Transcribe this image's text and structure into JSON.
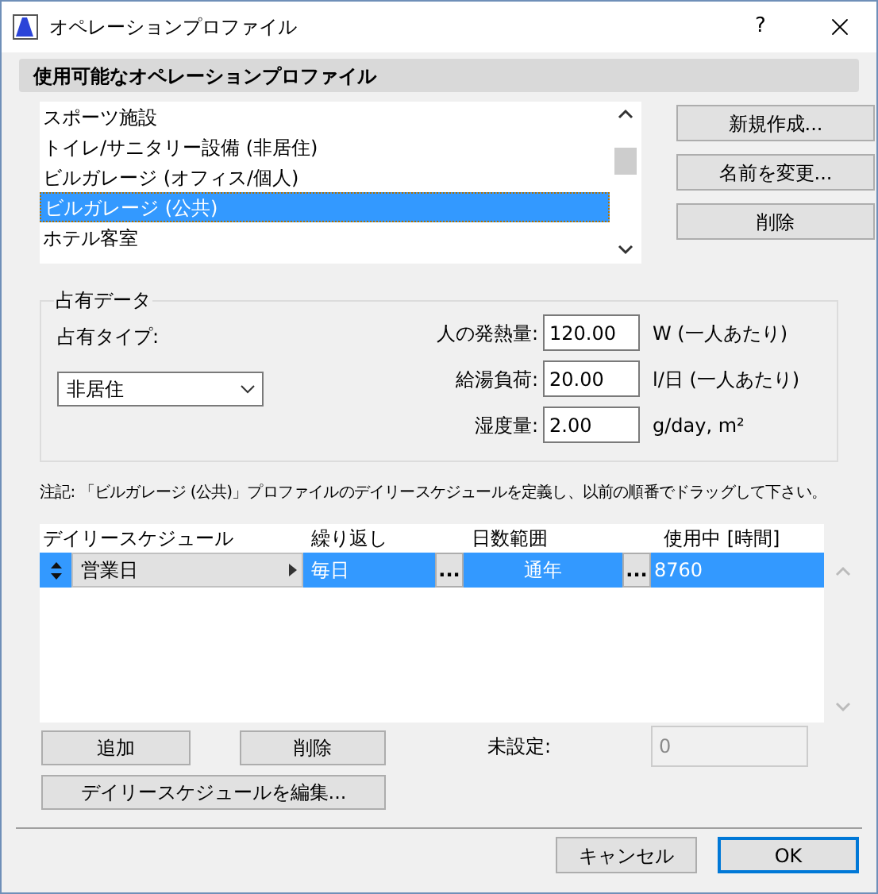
{
  "window": {
    "title": "オペレーションプロファイル",
    "help": "?"
  },
  "available_profiles": {
    "header": "使用可能なオペレーションプロファイル",
    "items": [
      {
        "label": "スポーツ施設",
        "selected": false
      },
      {
        "label": "トイレ/サニタリー設備 (非居住)",
        "selected": false
      },
      {
        "label": "ビルガレージ (オフィス/個人)",
        "selected": false
      },
      {
        "label": "ビルガレージ (公共)",
        "selected": true
      },
      {
        "label": "ホテル客室",
        "selected": false
      }
    ],
    "buttons": [
      "新規作成...",
      "名前を変更...",
      "削除"
    ]
  },
  "occupancy": {
    "title": "占有データ",
    "type_label": "占有タイプ:",
    "type_value": "非居住",
    "fields": [
      {
        "label": "人の発熱量:",
        "value": "120.00",
        "unit": "W (一人あたり)"
      },
      {
        "label": "給湯負荷:",
        "value": "20.00",
        "unit": "l/日 (一人あたり)"
      },
      {
        "label": "湿度量:",
        "value": "2.00",
        "unit": "g/day, m²"
      }
    ]
  },
  "note": "注記: 「ビルガレージ (公共)」プロファイルのデイリースケジュールを定義し、以前の順番でドラッグして下さい。",
  "schedule_table": {
    "columns": [
      "デイリースケジュール",
      "繰り返し",
      "日数範囲",
      "使用中 [時間]"
    ],
    "rows": [
      {
        "schedule": "営業日",
        "repeat": "毎日",
        "repeat_button": "...",
        "day_range": "通年",
        "day_range_button": "...",
        "hours": "8760",
        "selected": true
      }
    ]
  },
  "schedule_buttons": {
    "add": "追加",
    "delete": "削除",
    "edit": "デイリースケジュールを編集..."
  },
  "unset": {
    "label": "未設定:",
    "value": "0",
    "disabled": true
  },
  "footer_buttons": [
    {
      "label": "キャンセル",
      "default": false
    },
    {
      "label": "OK",
      "default": true
    }
  ]
}
